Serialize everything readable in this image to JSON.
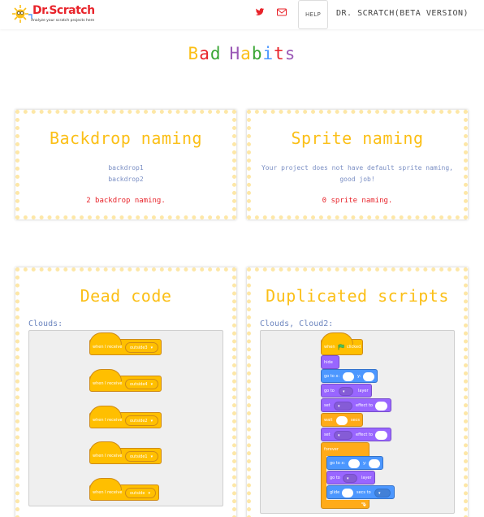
{
  "navbar": {
    "logo_title": "Dr.Scratch",
    "logo_tagline": "Analyze your scratch projects here",
    "help_label": "HELP",
    "title": "DR. SCRATCH(BETA VERSION)",
    "icons": [
      "twitter-icon",
      "mail-icon"
    ]
  },
  "page_title": {
    "letters": [
      "B",
      "a",
      "d",
      " ",
      "H",
      "a",
      "b",
      "i",
      "t",
      "s"
    ],
    "colors": [
      "#fbbf16",
      "#e8242b",
      "#3aa635",
      "#ffffff",
      "#9b59b6",
      "#fbbf16",
      "#3aa635",
      "#4c97ff",
      "#e8242b",
      "#9b59b6"
    ]
  },
  "backdrop_naming": {
    "title": "Backdrop naming",
    "items": [
      "backdrop1",
      "backdrop2"
    ],
    "count_text": "2 backdrop naming."
  },
  "sprite_naming": {
    "title": "Sprite naming",
    "message_line1": "Your project does not have default sprite naming,",
    "message_line2": "good job!",
    "count_text": "0 sprite naming."
  },
  "dead_code": {
    "title": "Dead code",
    "sprite_label": "Clouds:",
    "blocks": [
      {
        "text": "when I receive",
        "option": "outside3"
      },
      {
        "text": "when I receive",
        "option": "outside4"
      },
      {
        "text": "when I receive",
        "option": "outside2"
      },
      {
        "text": "when I receive",
        "option": "outside1"
      },
      {
        "text": "when I receive",
        "option": "outside"
      }
    ]
  },
  "duplicated_scripts": {
    "title": "Duplicated scripts",
    "sprite_label": "Clouds, Cloud2:",
    "script": {
      "hat_when": "when",
      "hat_clicked": "clicked",
      "hide": "hide",
      "goto_x": "go to x:",
      "y": "y:",
      "goto": "go to",
      "layer": "layer",
      "set": "set",
      "effect_to": "effect to",
      "wait": "wait",
      "secs": "secs",
      "forever": "forever",
      "glide": "glide",
      "secs_to": "secs to"
    }
  },
  "colors": {
    "accent_yellow": "#fbbf16",
    "count_red": "#e8242b",
    "text_blue": "#7b8fc4",
    "card_border": "#fde7a7"
  }
}
